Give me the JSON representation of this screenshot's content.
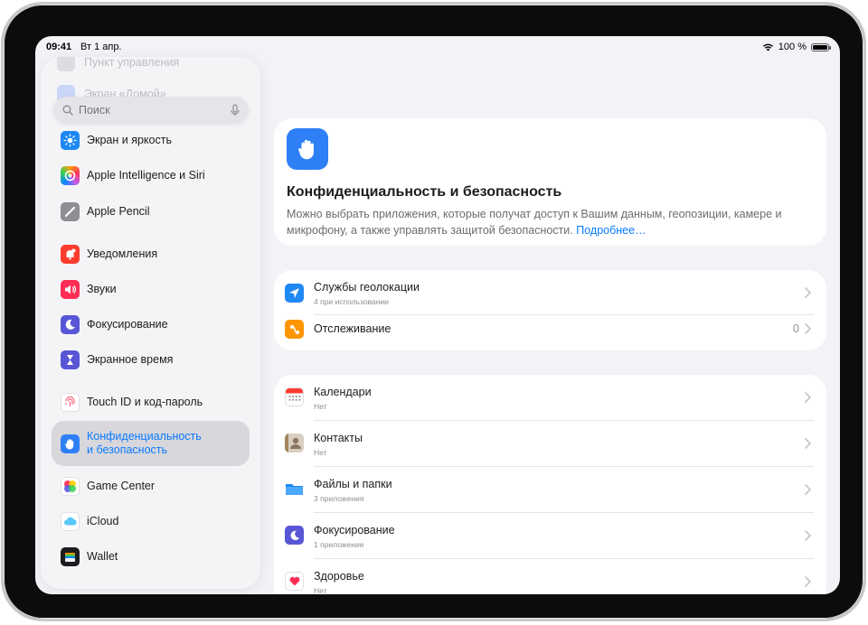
{
  "status": {
    "time": "09:41",
    "date": "Вт 1 апр.",
    "battery": "100 %"
  },
  "sidebar": {
    "faded": [
      "Пункт управления",
      "Экран «Домой»"
    ],
    "search_placeholder": "Поиск",
    "items": [
      {
        "label": "Экран и яркость",
        "icon": "sun-icon",
        "color": "#1e88f5"
      },
      {
        "label": "Apple Intelligence и Siri",
        "icon": "siri-icon",
        "color": "#d27bf4"
      },
      {
        "label": "Apple Pencil",
        "icon": "pencil-icon",
        "color": "#8e8e93"
      },
      {
        "label": "Уведомления",
        "icon": "bell-icon",
        "color": "#ff3b30"
      },
      {
        "label": "Звуки",
        "icon": "speaker-icon",
        "color": "#ff2d55"
      },
      {
        "label": "Фокусирование",
        "icon": "moon-icon",
        "color": "#5856d6"
      },
      {
        "label": "Экранное время",
        "icon": "hourglass-icon",
        "color": "#5856d6"
      },
      {
        "label": "Touch ID и код-пароль",
        "icon": "fingerprint-icon",
        "color": "#ff3b5c"
      },
      {
        "label_line1": "Конфиденциальность",
        "label_line2": "и безопасность",
        "icon": "hand-icon",
        "color": "#2f80f7",
        "active": true
      },
      {
        "label": "Game Center",
        "icon": "game-center-icon",
        "color": "#ff9500"
      },
      {
        "label": "iCloud",
        "icon": "cloud-icon",
        "color": "#5ac8fa"
      },
      {
        "label": "Wallet",
        "icon": "wallet-icon",
        "color": "#1c1c1e"
      }
    ]
  },
  "hero": {
    "title": "Конфиденциальность и безопасность",
    "description": "Можно выбрать приложения, которые получат доступ к Вашим данным, геопозиции, камере и микрофону, а также управлять защитой безопасности.",
    "link": "Подробнее…"
  },
  "group1": [
    {
      "title": "Службы геолокации",
      "subtitle": "4 при использовании",
      "icon": "location-arrow-icon",
      "color": "#1e88f5"
    },
    {
      "title": "Отслеживание",
      "value": "0",
      "icon": "tracking-icon",
      "color": "#ff9500"
    }
  ],
  "group2": [
    {
      "title": "Календари",
      "subtitle": "Нет",
      "icon": "calendar-icon",
      "color": "#ff3b30"
    },
    {
      "title": "Контакты",
      "subtitle": "Нет",
      "icon": "contacts-icon",
      "color": "#a2845e"
    },
    {
      "title": "Файлы и папки",
      "subtitle": "3 приложения",
      "icon": "folder-icon",
      "color": "#1e88f5"
    },
    {
      "title": "Фокусирование",
      "subtitle": "1 приложение",
      "icon": "moon-icon",
      "color": "#5856d6"
    },
    {
      "title": "Здоровье",
      "subtitle": "Нет",
      "icon": "heart-icon",
      "color": "#ff2d55"
    }
  ]
}
